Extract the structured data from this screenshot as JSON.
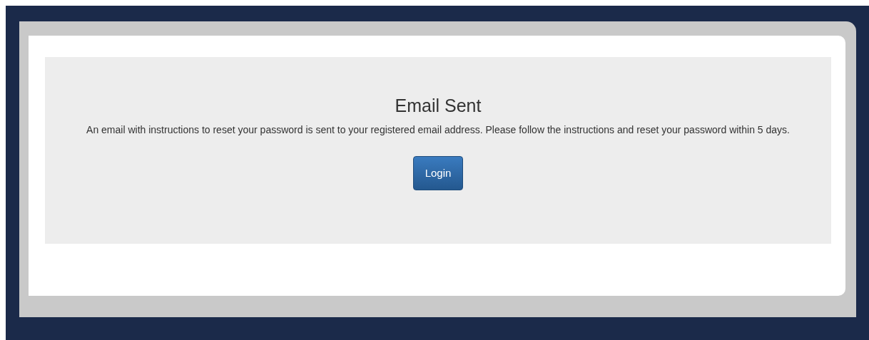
{
  "message": {
    "title": "Email Sent",
    "body": "An email with instructions to reset your password is sent to your registered email address. Please follow the instructions and reset your password within 5 days.",
    "button": "Login"
  }
}
